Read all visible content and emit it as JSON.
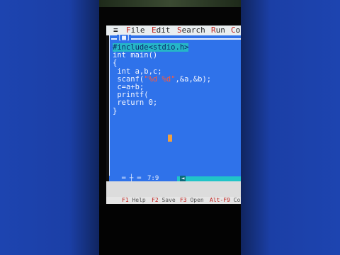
{
  "menu": {
    "system_icon": "≡",
    "items": [
      "File",
      "Edit",
      "Search",
      "Run",
      "Co"
    ]
  },
  "editor": {
    "close_box": "[■]",
    "lines": [
      {
        "parts": [
          {
            "t": "#include<stdio.h>",
            "c": "hl"
          }
        ]
      },
      {
        "parts": [
          {
            "t": "int main()",
            "c": ""
          }
        ]
      },
      {
        "parts": [
          {
            "t": "{",
            "c": ""
          }
        ]
      },
      {
        "parts": [
          {
            "t": " int a,b,c;",
            "c": ""
          }
        ]
      },
      {
        "parts": [
          {
            "t": " scanf(",
            "c": ""
          },
          {
            "t": "\"%d %d\"",
            "c": "str"
          },
          {
            "t": ",&a,&b);",
            "c": ""
          }
        ]
      },
      {
        "parts": [
          {
            "t": " c=a+b;",
            "c": ""
          }
        ]
      },
      {
        "parts": [
          {
            "t": " printf(",
            "c": ""
          }
        ]
      },
      {
        "parts": [
          {
            "t": " return 0;",
            "c": ""
          }
        ]
      },
      {
        "parts": [
          {
            "t": "}",
            "c": ""
          }
        ]
      }
    ],
    "cursor_position": "7:9",
    "bottom_marker": "═ ┼ ═"
  },
  "function_keys": [
    {
      "key": "F1",
      "label": "Help"
    },
    {
      "key": "F2",
      "label": "Save"
    },
    {
      "key": "F3",
      "label": "Open"
    },
    {
      "key": "Alt-F9",
      "label": "Co"
    }
  ],
  "colors": {
    "editor_bg": "#2f72ea",
    "menu_bg": "#e9eef0",
    "highlight": "#25b6c8",
    "string_red": "#ff5a3a"
  }
}
